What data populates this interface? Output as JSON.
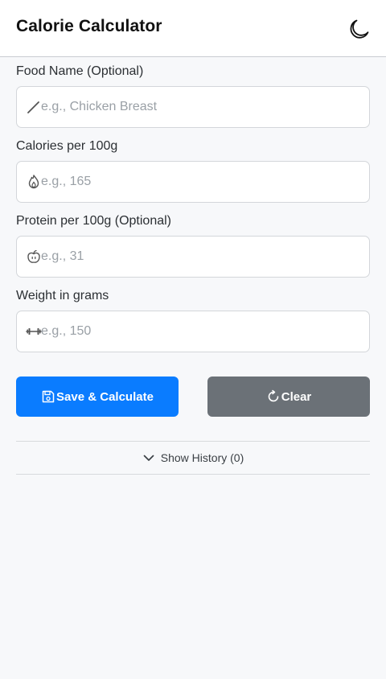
{
  "header": {
    "title": "Calorie Calculator",
    "theme_icon": "moon-icon"
  },
  "form": {
    "fields": [
      {
        "label": "Food Name (Optional)",
        "placeholder": "e.g., Chicken Breast",
        "value": "",
        "icon": "pencil-icon"
      },
      {
        "label": "Calories per 100g",
        "placeholder": "e.g., 165",
        "value": "",
        "icon": "flame-icon"
      },
      {
        "label": "Protein per 100g (Optional)",
        "placeholder": "e.g., 31",
        "value": "",
        "icon": "apple-icon"
      },
      {
        "label": "Weight in grams",
        "placeholder": "e.g., 150",
        "value": "",
        "icon": "dumbbell-icon"
      }
    ]
  },
  "actions": {
    "save_label": "Save & Calculate",
    "save_icon": "floppy-disk-icon",
    "clear_label": "Clear",
    "clear_icon": "refresh-icon"
  },
  "history": {
    "toggle_label": "Show History (0)",
    "toggle_icon": "chevron-down-icon"
  },
  "colors": {
    "primary": "#0a7cff",
    "secondary": "#6b7177",
    "background": "#f7f8fa"
  }
}
